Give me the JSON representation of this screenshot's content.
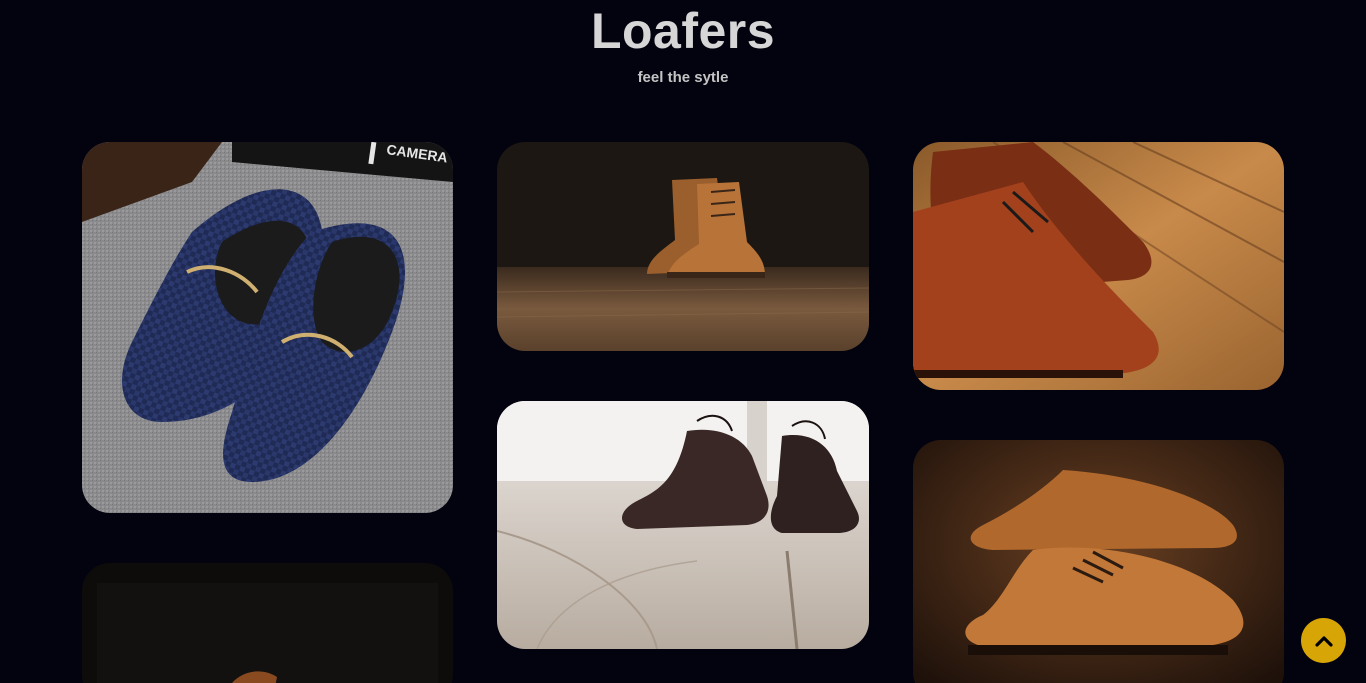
{
  "header": {
    "title": "Loafers",
    "subtitle": "feel the sytle"
  },
  "gallery": {
    "items": [
      {
        "subject": "navy woven loafers with gold horsebit on grey carpet",
        "overlay_text": "CAMERA"
      },
      {
        "subject": "tan leather ankle boots on wooden floor"
      },
      {
        "subject": "brown leather chukka shoes on wooden floor"
      },
      {
        "subject": "brown shoe on dark background"
      },
      {
        "subject": "dark brown brogue shoes on light wooden floor"
      },
      {
        "subject": "tan wingtip oxford shoes on dark wood"
      }
    ]
  },
  "scroll_to_top": {
    "icon": "chevron-up-icon",
    "color": "#d8a507"
  },
  "colors": {
    "background": "#03030f",
    "title": "#d6d6d6",
    "subtitle": "#c4c4c4",
    "accent": "#d8a507"
  }
}
